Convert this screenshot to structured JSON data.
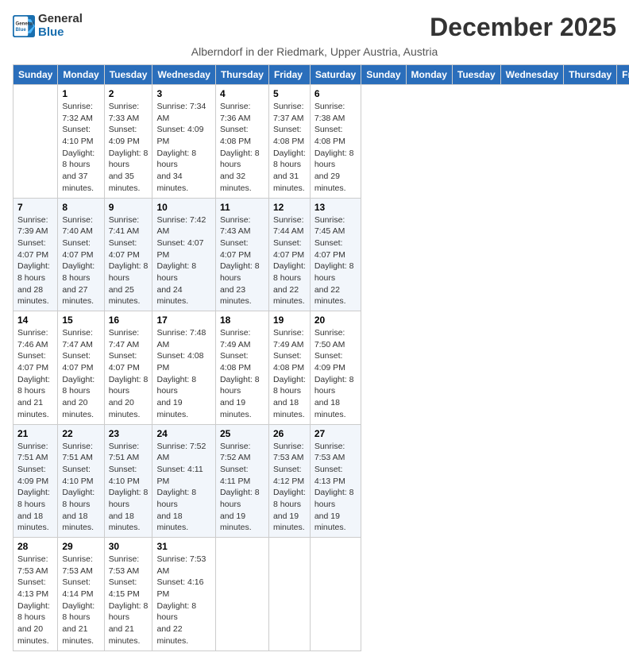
{
  "logo": {
    "general": "General",
    "blue": "Blue"
  },
  "title": "December 2025",
  "location": "Alberndorf in der Riedmark, Upper Austria, Austria",
  "weekdays": [
    "Sunday",
    "Monday",
    "Tuesday",
    "Wednesday",
    "Thursday",
    "Friday",
    "Saturday"
  ],
  "weeks": [
    [
      {
        "day": "",
        "info": ""
      },
      {
        "day": "1",
        "info": "Sunrise: 7:32 AM\nSunset: 4:10 PM\nDaylight: 8 hours\nand 37 minutes."
      },
      {
        "day": "2",
        "info": "Sunrise: 7:33 AM\nSunset: 4:09 PM\nDaylight: 8 hours\nand 35 minutes."
      },
      {
        "day": "3",
        "info": "Sunrise: 7:34 AM\nSunset: 4:09 PM\nDaylight: 8 hours\nand 34 minutes."
      },
      {
        "day": "4",
        "info": "Sunrise: 7:36 AM\nSunset: 4:08 PM\nDaylight: 8 hours\nand 32 minutes."
      },
      {
        "day": "5",
        "info": "Sunrise: 7:37 AM\nSunset: 4:08 PM\nDaylight: 8 hours\nand 31 minutes."
      },
      {
        "day": "6",
        "info": "Sunrise: 7:38 AM\nSunset: 4:08 PM\nDaylight: 8 hours\nand 29 minutes."
      }
    ],
    [
      {
        "day": "7",
        "info": "Sunrise: 7:39 AM\nSunset: 4:07 PM\nDaylight: 8 hours\nand 28 minutes."
      },
      {
        "day": "8",
        "info": "Sunrise: 7:40 AM\nSunset: 4:07 PM\nDaylight: 8 hours\nand 27 minutes."
      },
      {
        "day": "9",
        "info": "Sunrise: 7:41 AM\nSunset: 4:07 PM\nDaylight: 8 hours\nand 25 minutes."
      },
      {
        "day": "10",
        "info": "Sunrise: 7:42 AM\nSunset: 4:07 PM\nDaylight: 8 hours\nand 24 minutes."
      },
      {
        "day": "11",
        "info": "Sunrise: 7:43 AM\nSunset: 4:07 PM\nDaylight: 8 hours\nand 23 minutes."
      },
      {
        "day": "12",
        "info": "Sunrise: 7:44 AM\nSunset: 4:07 PM\nDaylight: 8 hours\nand 22 minutes."
      },
      {
        "day": "13",
        "info": "Sunrise: 7:45 AM\nSunset: 4:07 PM\nDaylight: 8 hours\nand 22 minutes."
      }
    ],
    [
      {
        "day": "14",
        "info": "Sunrise: 7:46 AM\nSunset: 4:07 PM\nDaylight: 8 hours\nand 21 minutes."
      },
      {
        "day": "15",
        "info": "Sunrise: 7:47 AM\nSunset: 4:07 PM\nDaylight: 8 hours\nand 20 minutes."
      },
      {
        "day": "16",
        "info": "Sunrise: 7:47 AM\nSunset: 4:07 PM\nDaylight: 8 hours\nand 20 minutes."
      },
      {
        "day": "17",
        "info": "Sunrise: 7:48 AM\nSunset: 4:08 PM\nDaylight: 8 hours\nand 19 minutes."
      },
      {
        "day": "18",
        "info": "Sunrise: 7:49 AM\nSunset: 4:08 PM\nDaylight: 8 hours\nand 19 minutes."
      },
      {
        "day": "19",
        "info": "Sunrise: 7:49 AM\nSunset: 4:08 PM\nDaylight: 8 hours\nand 18 minutes."
      },
      {
        "day": "20",
        "info": "Sunrise: 7:50 AM\nSunset: 4:09 PM\nDaylight: 8 hours\nand 18 minutes."
      }
    ],
    [
      {
        "day": "21",
        "info": "Sunrise: 7:51 AM\nSunset: 4:09 PM\nDaylight: 8 hours\nand 18 minutes."
      },
      {
        "day": "22",
        "info": "Sunrise: 7:51 AM\nSunset: 4:10 PM\nDaylight: 8 hours\nand 18 minutes."
      },
      {
        "day": "23",
        "info": "Sunrise: 7:51 AM\nSunset: 4:10 PM\nDaylight: 8 hours\nand 18 minutes."
      },
      {
        "day": "24",
        "info": "Sunrise: 7:52 AM\nSunset: 4:11 PM\nDaylight: 8 hours\nand 18 minutes."
      },
      {
        "day": "25",
        "info": "Sunrise: 7:52 AM\nSunset: 4:11 PM\nDaylight: 8 hours\nand 19 minutes."
      },
      {
        "day": "26",
        "info": "Sunrise: 7:53 AM\nSunset: 4:12 PM\nDaylight: 8 hours\nand 19 minutes."
      },
      {
        "day": "27",
        "info": "Sunrise: 7:53 AM\nSunset: 4:13 PM\nDaylight: 8 hours\nand 19 minutes."
      }
    ],
    [
      {
        "day": "28",
        "info": "Sunrise: 7:53 AM\nSunset: 4:13 PM\nDaylight: 8 hours\nand 20 minutes."
      },
      {
        "day": "29",
        "info": "Sunrise: 7:53 AM\nSunset: 4:14 PM\nDaylight: 8 hours\nand 21 minutes."
      },
      {
        "day": "30",
        "info": "Sunrise: 7:53 AM\nSunset: 4:15 PM\nDaylight: 8 hours\nand 21 minutes."
      },
      {
        "day": "31",
        "info": "Sunrise: 7:53 AM\nSunset: 4:16 PM\nDaylight: 8 hours\nand 22 minutes."
      },
      {
        "day": "",
        "info": ""
      },
      {
        "day": "",
        "info": ""
      },
      {
        "day": "",
        "info": ""
      }
    ]
  ]
}
